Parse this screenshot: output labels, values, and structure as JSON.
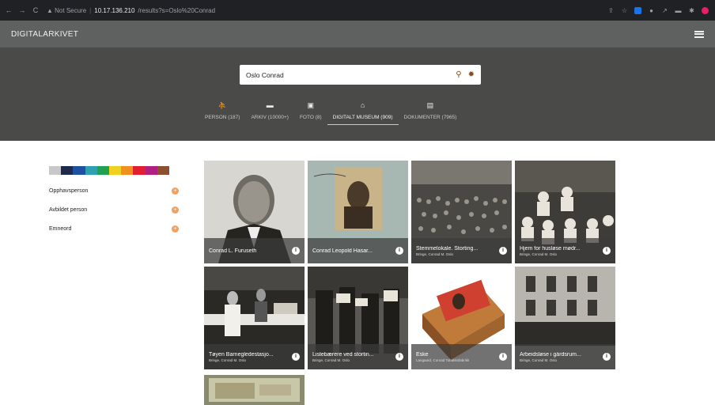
{
  "browser": {
    "nav": [
      "←",
      "→",
      "C"
    ],
    "security_label": "▲ Not Secure",
    "host": "10.17.136.210",
    "path": "/results?s=Oslo%20Conrad"
  },
  "app": {
    "brand": "DIGITALARKIVET"
  },
  "search": {
    "value": "Oslo Conrad",
    "placeholder": ""
  },
  "tabs": [
    {
      "label": "PERSON (187)",
      "icon": "person-icon",
      "glyph": "⛹"
    },
    {
      "label": "ARKIV (10000+)",
      "icon": "folder-icon",
      "glyph": "▬"
    },
    {
      "label": "FOTO (8)",
      "icon": "photo-icon",
      "glyph": "▣"
    },
    {
      "label": "DIGITALT MUSEUM (909)",
      "icon": "museum-icon",
      "glyph": "⌂"
    },
    {
      "label": "DOKUMENTER (7965)",
      "icon": "document-icon",
      "glyph": "▤"
    }
  ],
  "active_tab": "DIGITALT MUSEUM (909)",
  "palette": [
    "#c8c8c8",
    "#1e2a4a",
    "#2050a0",
    "#30a0b0",
    "#20a050",
    "#f0d020",
    "#f09020",
    "#e02030",
    "#b02080",
    "#8a5030"
  ],
  "facets": [
    {
      "label": "Opphavsperson"
    },
    {
      "label": "Avbildet person"
    },
    {
      "label": "Emneord"
    }
  ],
  "cards": [
    {
      "title": "Conrad L. Furuseth",
      "subtitle": "",
      "icon": "info-icon"
    },
    {
      "title": "Conrad Leopold Hasar...",
      "subtitle": "",
      "icon": "info-icon"
    },
    {
      "title": "Stemmelokale. Storting...",
      "subtitle": "Bringe, Conrad M. Oslo",
      "icon": "info-icon"
    },
    {
      "title": "Hjem for husløse mødr...",
      "subtitle": "Bringe, Conrad M. Oslo",
      "icon": "info-icon"
    },
    {
      "title": "Tøyen Barnegledestasjo...",
      "subtitle": "Bringe, Conrad M. Oslo",
      "icon": "info-icon"
    },
    {
      "title": "Listebærere ved stortin...",
      "subtitle": "Bringe, Conrad M. Oslo",
      "icon": "info-icon"
    },
    {
      "title": "Eske",
      "subtitle": "Langaard, Conrad Tobakksfabrikk",
      "icon": "info-icon"
    },
    {
      "title": "Arbeidsløse i gårdsrum...",
      "subtitle": "Bringe, Conrad M. Oslo",
      "icon": "info-icon"
    }
  ],
  "colors": {
    "header": "#5f6161",
    "hero": "#4a4a48",
    "accent": "#f0a061",
    "search_icon": "#8a4a1a"
  }
}
